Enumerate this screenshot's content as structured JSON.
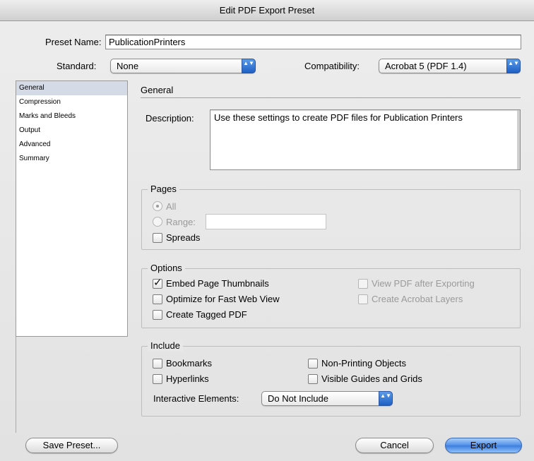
{
  "window": {
    "title": "Edit PDF Export Preset"
  },
  "preset": {
    "label": "Preset Name:",
    "value": "PublicationPrinters"
  },
  "standard": {
    "label": "Standard:",
    "value": "None"
  },
  "compatibility": {
    "label": "Compatibility:",
    "value": "Acrobat 5 (PDF 1.4)"
  },
  "sidebar": {
    "items": [
      {
        "label": "General",
        "selected": true
      },
      {
        "label": "Compression",
        "selected": false
      },
      {
        "label": "Marks and Bleeds",
        "selected": false
      },
      {
        "label": "Output",
        "selected": false
      },
      {
        "label": "Advanced",
        "selected": false
      },
      {
        "label": "Summary",
        "selected": false
      }
    ]
  },
  "general": {
    "title": "General",
    "description_label": "Description:",
    "description": "Use these settings to create PDF files for Publication Printers"
  },
  "pages": {
    "title": "Pages",
    "all_label": "All",
    "range_label": "Range:",
    "range_value": "",
    "spreads_label": "Spreads",
    "all_selected": true,
    "spreads_checked": false
  },
  "options": {
    "title": "Options",
    "embed_thumbnails": "Embed Page Thumbnails",
    "embed_thumbnails_checked": true,
    "optimize_fast_web": "Optimize for Fast Web View",
    "optimize_fast_web_checked": false,
    "create_tagged": "Create Tagged PDF",
    "create_tagged_checked": false,
    "view_after": "View PDF after Exporting",
    "view_after_checked": false,
    "acrobat_layers": "Create Acrobat Layers",
    "acrobat_layers_checked": false
  },
  "include": {
    "title": "Include",
    "bookmarks": "Bookmarks",
    "hyperlinks": "Hyperlinks",
    "non_printing": "Non-Printing Objects",
    "visible_guides": "Visible Guides and Grids",
    "interactive_label": "Interactive Elements:",
    "interactive_value": "Do Not Include"
  },
  "buttons": {
    "save_preset": "Save Preset...",
    "cancel": "Cancel",
    "export": "Export"
  },
  "icons": {
    "popup_arrows": "▲▼",
    "check": "✓"
  }
}
